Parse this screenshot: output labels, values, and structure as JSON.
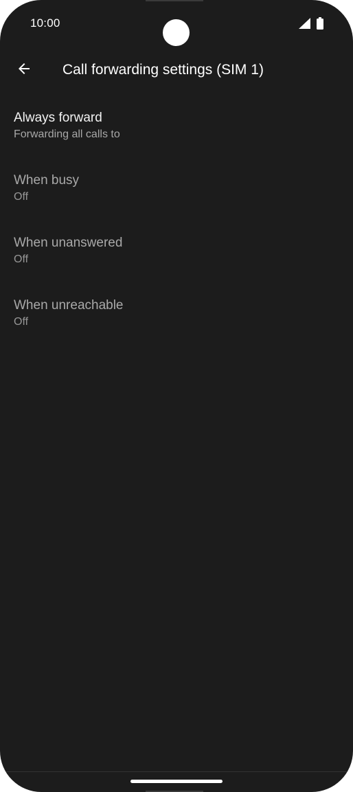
{
  "status_bar": {
    "time": "10:00",
    "signal_icon": "cellular-signal-icon",
    "battery_icon": "battery-icon"
  },
  "app_bar": {
    "back_icon": "arrow-back-icon",
    "title": "Call forwarding settings (SIM 1)"
  },
  "items": [
    {
      "title": "Always forward",
      "summary": "Forwarding all calls to"
    },
    {
      "title": "When busy",
      "summary": "Off"
    },
    {
      "title": "When unanswered",
      "summary": "Off"
    },
    {
      "title": "When unreachable",
      "summary": "Off"
    }
  ],
  "colors": {
    "background": "#1c1c1c",
    "text_primary": "#f2f2f2",
    "text_secondary": "#a8a8a8"
  }
}
